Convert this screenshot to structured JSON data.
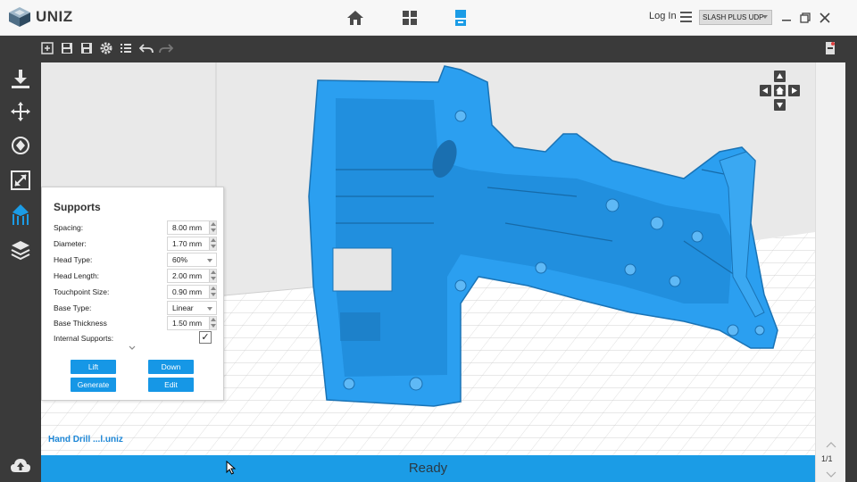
{
  "app": {
    "logo_text": "UNIZ",
    "login_label": "Log In",
    "printer_selected": "SLASH PLUS UDP"
  },
  "nav_tabs": [
    {
      "name": "home",
      "icon": "home-icon"
    },
    {
      "name": "library",
      "icon": "grid-icon"
    },
    {
      "name": "print",
      "icon": "printer-tray-icon",
      "active": true
    }
  ],
  "toolbar": {
    "icons": [
      "add-file-icon",
      "save-icon",
      "save-as-icon",
      "settings-gear-icon",
      "list-icon",
      "undo-icon",
      "redo-icon"
    ]
  },
  "sidebar": {
    "icons": [
      "import-download-icon",
      "move-arrows-icon",
      "rotate-icon",
      "scale-icon",
      "supports-icon",
      "layers-icon",
      "upload-cloud-icon"
    ],
    "active": "supports-icon"
  },
  "supports_panel": {
    "title": "Supports",
    "fields": [
      {
        "label": "Spacing:",
        "value": "8.00 mm",
        "kind": "spin"
      },
      {
        "label": "Diameter:",
        "value": "1.70 mm",
        "kind": "spin"
      },
      {
        "label": "Head Type:",
        "value": "60%",
        "kind": "select"
      },
      {
        "label": "Head Length:",
        "value": "2.00 mm",
        "kind": "spin"
      },
      {
        "label": "Touchpoint Size:",
        "value": "0.90 mm",
        "kind": "spin"
      },
      {
        "label": "Base Type:",
        "value": "Linear",
        "kind": "select"
      },
      {
        "label": "Base Thickness",
        "value": "1.50 mm",
        "kind": "spin"
      }
    ],
    "internal_supports_label": "Internal Supports:",
    "internal_supports_checked": "✓",
    "buttons": {
      "lift": "Lift",
      "down": "Down",
      "generate": "Generate",
      "edit": "Edit"
    }
  },
  "viewport": {
    "model_name": "Hand Drill ...l.uniz",
    "model_color": "#2b9ff0"
  },
  "status": {
    "text": "Ready"
  },
  "pager": {
    "text": "1/1"
  },
  "colors": {
    "accent": "#1b9ce6",
    "dark_chrome": "#3a3a3a",
    "model_blue": "#2b9ff0"
  }
}
